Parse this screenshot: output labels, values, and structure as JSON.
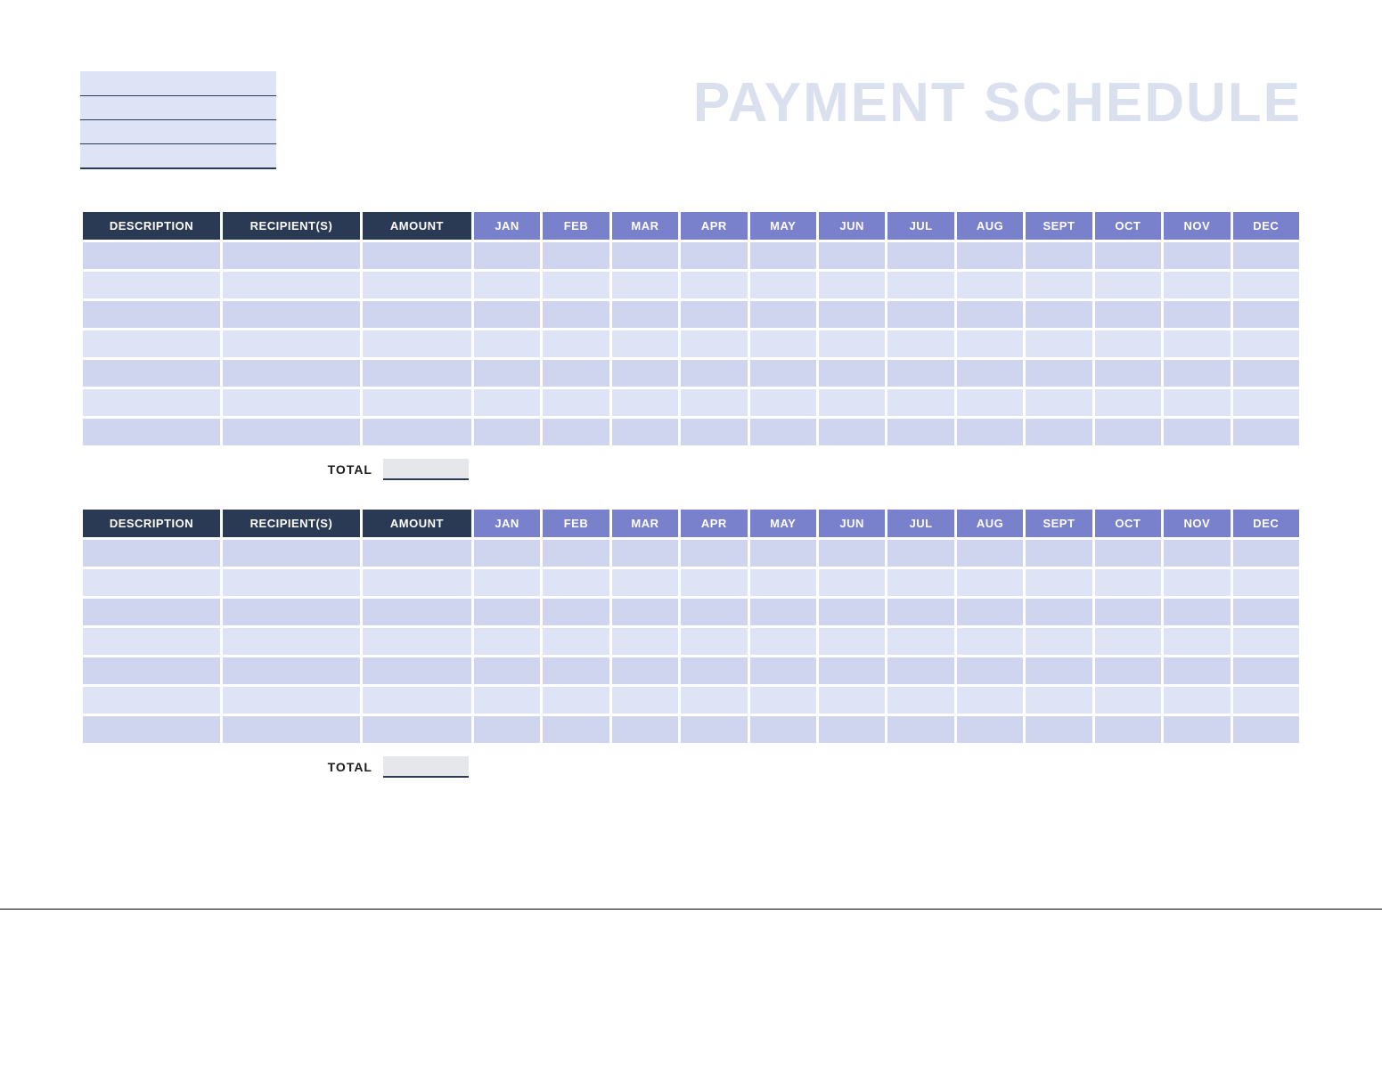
{
  "title": "PAYMENT SCHEDULE",
  "info_lines": [
    "",
    "",
    "",
    ""
  ],
  "columns": {
    "description": "DESCRIPTION",
    "recipients": "RECIPIENT(S)",
    "amount": "AMOUNT",
    "months": [
      "JAN",
      "FEB",
      "MAR",
      "APR",
      "MAY",
      "JUN",
      "JUL",
      "AUG",
      "SEPT",
      "OCT",
      "NOV",
      "DEC"
    ]
  },
  "sections": [
    {
      "rows": [
        {
          "description": "",
          "recipients": "",
          "amount": "",
          "months": [
            "",
            "",
            "",
            "",
            "",
            "",
            "",
            "",
            "",
            "",
            "",
            ""
          ]
        },
        {
          "description": "",
          "recipients": "",
          "amount": "",
          "months": [
            "",
            "",
            "",
            "",
            "",
            "",
            "",
            "",
            "",
            "",
            "",
            ""
          ]
        },
        {
          "description": "",
          "recipients": "",
          "amount": "",
          "months": [
            "",
            "",
            "",
            "",
            "",
            "",
            "",
            "",
            "",
            "",
            "",
            ""
          ]
        },
        {
          "description": "",
          "recipients": "",
          "amount": "",
          "months": [
            "",
            "",
            "",
            "",
            "",
            "",
            "",
            "",
            "",
            "",
            "",
            ""
          ]
        },
        {
          "description": "",
          "recipients": "",
          "amount": "",
          "months": [
            "",
            "",
            "",
            "",
            "",
            "",
            "",
            "",
            "",
            "",
            "",
            ""
          ]
        },
        {
          "description": "",
          "recipients": "",
          "amount": "",
          "months": [
            "",
            "",
            "",
            "",
            "",
            "",
            "",
            "",
            "",
            "",
            "",
            ""
          ]
        },
        {
          "description": "",
          "recipients": "",
          "amount": "",
          "months": [
            "",
            "",
            "",
            "",
            "",
            "",
            "",
            "",
            "",
            "",
            "",
            ""
          ]
        }
      ],
      "total_label": "TOTAL",
      "total_value": ""
    },
    {
      "rows": [
        {
          "description": "",
          "recipients": "",
          "amount": "",
          "months": [
            "",
            "",
            "",
            "",
            "",
            "",
            "",
            "",
            "",
            "",
            "",
            ""
          ]
        },
        {
          "description": "",
          "recipients": "",
          "amount": "",
          "months": [
            "",
            "",
            "",
            "",
            "",
            "",
            "",
            "",
            "",
            "",
            "",
            ""
          ]
        },
        {
          "description": "",
          "recipients": "",
          "amount": "",
          "months": [
            "",
            "",
            "",
            "",
            "",
            "",
            "",
            "",
            "",
            "",
            "",
            ""
          ]
        },
        {
          "description": "",
          "recipients": "",
          "amount": "",
          "months": [
            "",
            "",
            "",
            "",
            "",
            "",
            "",
            "",
            "",
            "",
            "",
            ""
          ]
        },
        {
          "description": "",
          "recipients": "",
          "amount": "",
          "months": [
            "",
            "",
            "",
            "",
            "",
            "",
            "",
            "",
            "",
            "",
            "",
            ""
          ]
        },
        {
          "description": "",
          "recipients": "",
          "amount": "",
          "months": [
            "",
            "",
            "",
            "",
            "",
            "",
            "",
            "",
            "",
            "",
            "",
            ""
          ]
        },
        {
          "description": "",
          "recipients": "",
          "amount": "",
          "months": [
            "",
            "",
            "",
            "",
            "",
            "",
            "",
            "",
            "",
            "",
            "",
            ""
          ]
        }
      ],
      "total_label": "TOTAL",
      "total_value": ""
    }
  ]
}
